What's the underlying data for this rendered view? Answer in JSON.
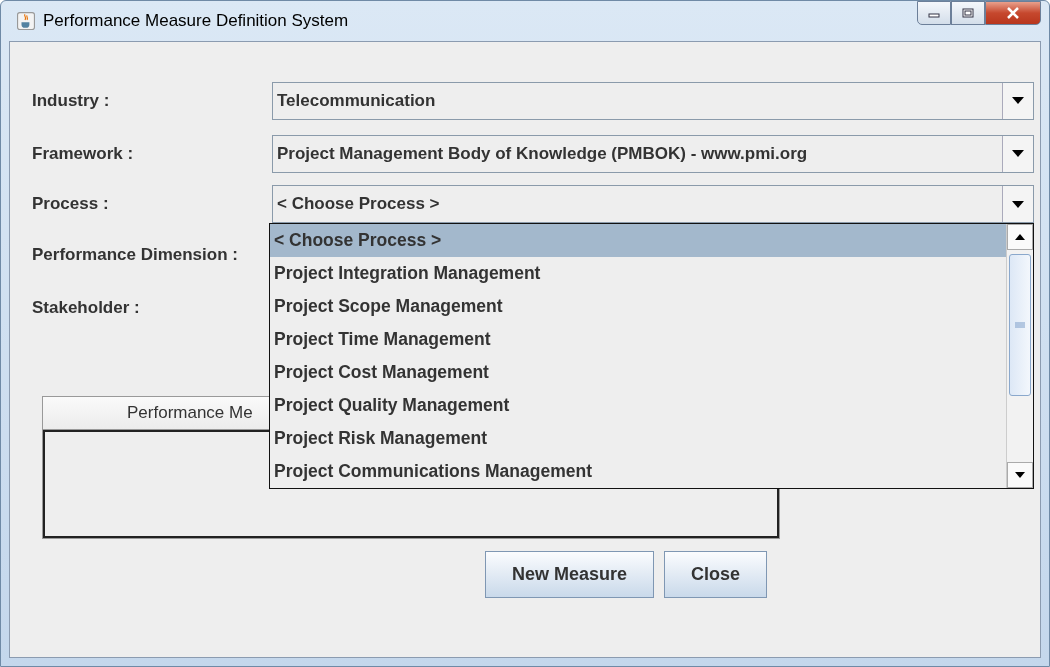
{
  "window": {
    "title": "Performance Measure Definition System"
  },
  "form": {
    "fields": [
      {
        "label": "Industry :",
        "value": "Telecommunication"
      },
      {
        "label": "Framework :",
        "value": "Project Management Body of Knowledge (PMBOK) - www.pmi.org"
      },
      {
        "label": "Process :",
        "value": "< Choose Process >"
      },
      {
        "label": "Performance Dimension :"
      },
      {
        "label": "Stakeholder :"
      }
    ]
  },
  "dropdown": {
    "items": [
      {
        "label": "< Choose Process >",
        "selected": true
      },
      {
        "label": "Project Integration Management",
        "selected": false
      },
      {
        "label": "Project Scope Management",
        "selected": false
      },
      {
        "label": "Project Time Management",
        "selected": false
      },
      {
        "label": "Project Cost Management",
        "selected": false
      },
      {
        "label": "Project Quality Management",
        "selected": false
      },
      {
        "label": "Project Risk Management",
        "selected": false
      },
      {
        "label": "Project Communications Management",
        "selected": false
      }
    ]
  },
  "table": {
    "columns": [
      "Performance Me"
    ]
  },
  "buttons": [
    "New Measure",
    "Close"
  ]
}
